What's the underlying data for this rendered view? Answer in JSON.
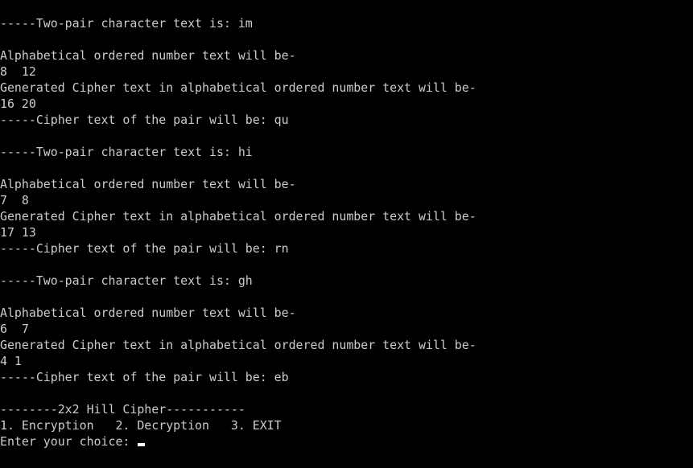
{
  "console": {
    "lines": [
      "-----Two-pair character text is: im",
      "",
      "Alphabetical ordered number text will be-",
      "8  12",
      "Generated Cipher text in alphabetical ordered number text will be-",
      "16 20",
      "-----Cipher text of the pair will be: qu",
      "",
      "-----Two-pair character text is: hi",
      "",
      "Alphabetical ordered number text will be-",
      "7  8",
      "Generated Cipher text in alphabetical ordered number text will be-",
      "17 13",
      "-----Cipher text of the pair will be: rn",
      "",
      "-----Two-pair character text is: gh",
      "",
      "Alphabetical ordered number text will be-",
      "6  7",
      "Generated Cipher text in alphabetical ordered number text will be-",
      "4 1",
      "-----Cipher text of the pair will be: eb",
      "",
      "--------2x2 Hill Cipher-----------",
      "1. Encryption   2. Decryption   3. EXIT"
    ],
    "prompt": "Enter your choice: "
  },
  "colors": {
    "background": "#000000",
    "text": "#cccccc",
    "cursor": "#ffffff"
  }
}
